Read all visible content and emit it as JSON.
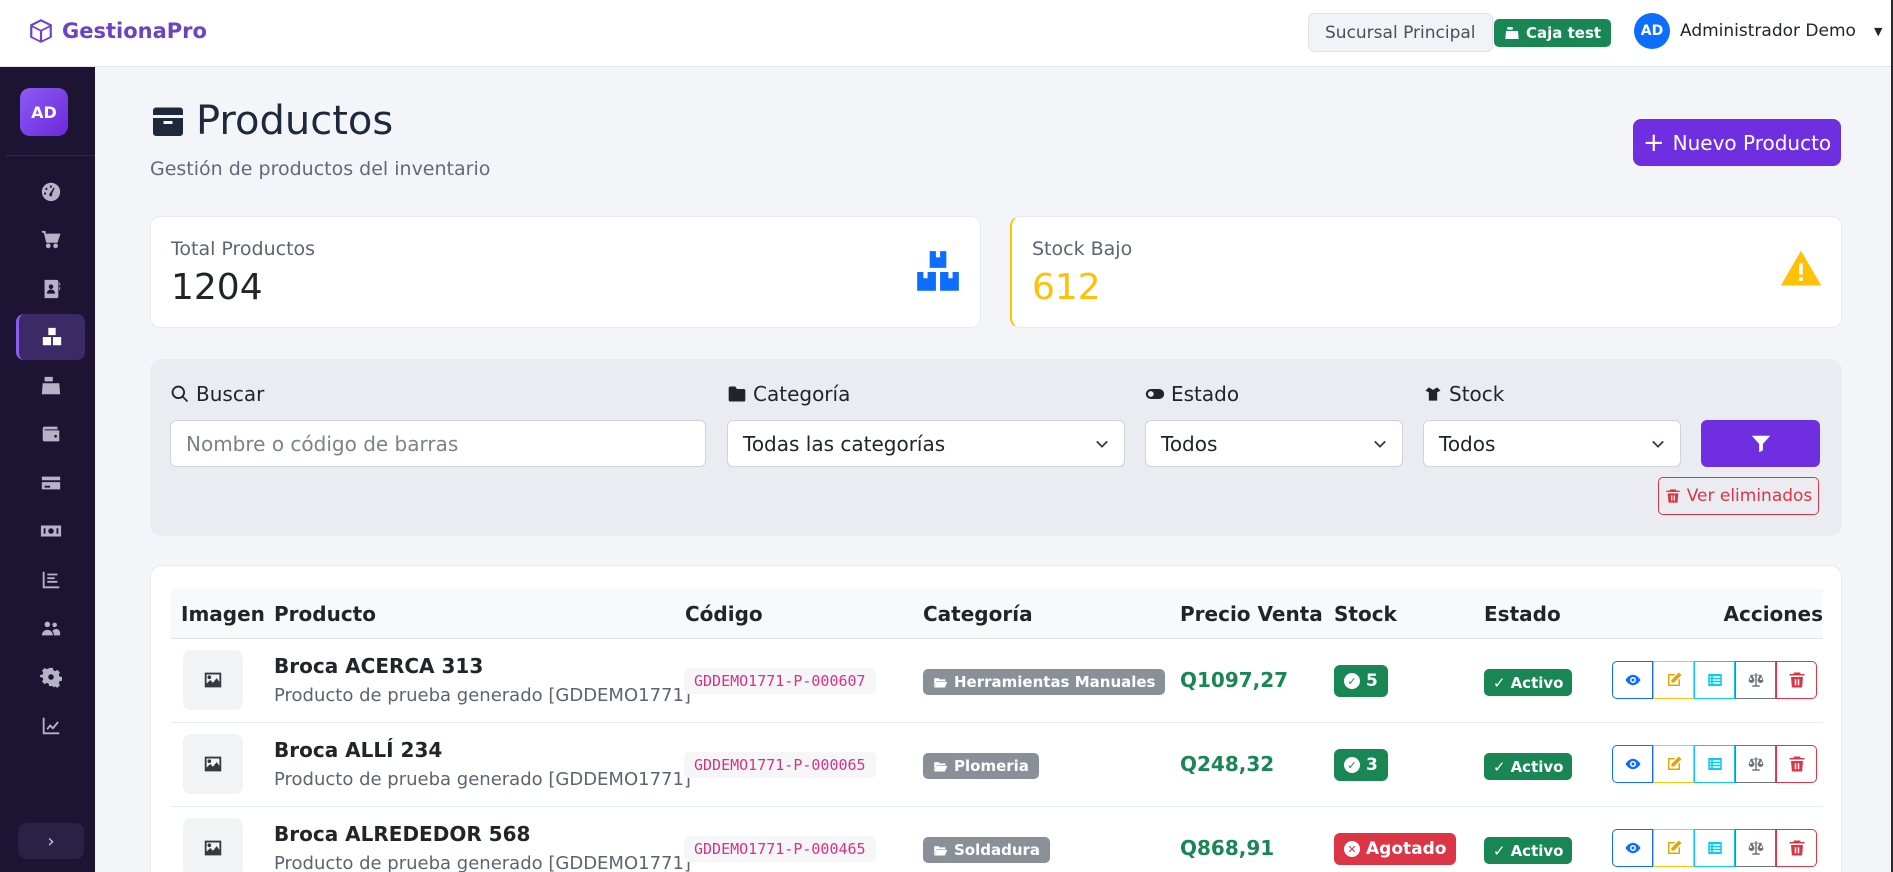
{
  "header": {
    "brand": "GestionaPro",
    "branch": "Sucursal Principal",
    "caja": "Caja test",
    "user_initials": "AD",
    "user_name": "Administrador Demo"
  },
  "sidebar": {
    "avatar": "AD",
    "items": [
      {
        "icon": "dashboard-icon"
      },
      {
        "icon": "cart-icon"
      },
      {
        "icon": "address-book-icon"
      },
      {
        "icon": "boxes-icon",
        "active": true
      },
      {
        "icon": "cash-register-icon"
      },
      {
        "icon": "wallet-icon"
      },
      {
        "icon": "credit-card-icon"
      },
      {
        "icon": "money-icon"
      },
      {
        "icon": "list-chart-icon"
      },
      {
        "icon": "users-icon"
      },
      {
        "icon": "settings-icon"
      },
      {
        "icon": "line-chart-icon"
      }
    ]
  },
  "page": {
    "title": "Productos",
    "subtitle": "Gestión de productos del inventario",
    "new_button": "Nuevo Producto"
  },
  "stats": {
    "total_label": "Total Productos",
    "total_value": "1204",
    "low_label": "Stock Bajo",
    "low_value": "612"
  },
  "filters": {
    "search_label": "Buscar",
    "search_placeholder": "Nombre o código de barras",
    "category_label": "Categoría",
    "category_value": "Todas las categorías",
    "status_label": "Estado",
    "status_value": "Todos",
    "stock_label": "Stock",
    "stock_value": "Todos",
    "deleted_button": "Ver eliminados"
  },
  "table": {
    "headers": [
      "Imagen",
      "Producto",
      "Código",
      "Categoría",
      "Precio Venta",
      "Stock",
      "Estado",
      "Acciones"
    ],
    "rows": [
      {
        "name": "Broca ACERCA 313",
        "desc": "Producto de prueba generado [GDDEMO1771]",
        "code": "GDDEMO1771-P-000607",
        "category": "Herramientas Manuales",
        "price": "Q1097,27",
        "stock": "5",
        "stock_state": "ok",
        "status": "Activo"
      },
      {
        "name": "Broca ALLÍ 234",
        "desc": "Producto de prueba generado [GDDEMO1771]",
        "code": "GDDEMO1771-P-000065",
        "category": "Plomeria",
        "price": "Q248,32",
        "stock": "3",
        "stock_state": "ok",
        "status": "Activo"
      },
      {
        "name": "Broca ALREDEDOR 568",
        "desc": "Producto de prueba generado [GDDEMO1771]",
        "code": "GDDEMO1771-P-000465",
        "category": "Soldadura",
        "price": "Q868,91",
        "stock": "Agotado",
        "stock_state": "out",
        "status": "Activo"
      }
    ]
  },
  "colors": {
    "primary": "#6f2fe0",
    "sidebar": "#1d1433",
    "success": "#198754",
    "danger": "#dc3545",
    "warning": "#ffc107",
    "info_blue": "#0d6efd"
  }
}
